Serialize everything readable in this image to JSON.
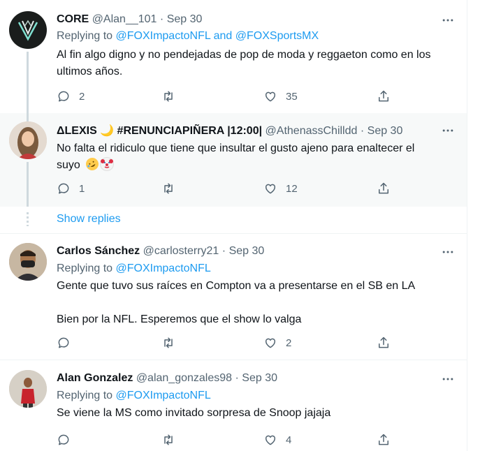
{
  "tweets": [
    {
      "name": "CORE",
      "handle": "@Alan__101",
      "date": "Sep 30",
      "replying_prefix": "Replying to ",
      "replying_to": "@FOXImpactoNFL and @FOXSportsMX",
      "text_lines": [
        "Al fin algo digno y no pendejadas de pop de moda y reggaeton como en los",
        "ultimos años."
      ],
      "replies": "2",
      "retweets": "",
      "likes": "35"
    },
    {
      "name": "ΔLEXIS 🌙 #RENUNCIAPIÑERA |12:00|",
      "handle": "@AthenassChilldd",
      "date": "Sep 30",
      "text_lines": [
        "No falta el ridiculo que tiene que insultar el gusto ajeno para enaltecer el",
        "suyo"
      ],
      "emojis": [
        "rolling-on-floor-laughing",
        "clown-face"
      ],
      "replies": "1",
      "retweets": "",
      "likes": "12"
    },
    {
      "name": "Carlos Sánchez",
      "handle": "@carlosterry21",
      "date": "Sep 30",
      "replying_prefix": "Replying to ",
      "replying_to": "@FOXImpactoNFL",
      "text_lines": [
        "Gente que tuvo sus raíces en Compton va a presentarse en el SB en LA",
        "",
        "Bien por la NFL. Esperemos que el show lo valga"
      ],
      "replies": "",
      "retweets": "",
      "likes": "2"
    },
    {
      "name": "Alan Gonzalez",
      "handle": "@alan_gonzales98",
      "date": "Sep 30",
      "replying_prefix": "Replying to ",
      "replying_to": "@FOXImpactoNFL",
      "text_lines": [
        "Se viene la MS como invitado sorpresa de Snoop jajaja"
      ],
      "replies": "",
      "retweets": "",
      "likes": "4"
    }
  ],
  "show_replies": "Show replies",
  "separator": "·",
  "colors": {
    "accent": "#1d9bf0",
    "secondary_text": "#536471",
    "hover_bg": "#f7f9f9"
  },
  "icons": [
    "more-icon",
    "reply-icon",
    "retweet-icon",
    "like-icon",
    "share-icon"
  ]
}
